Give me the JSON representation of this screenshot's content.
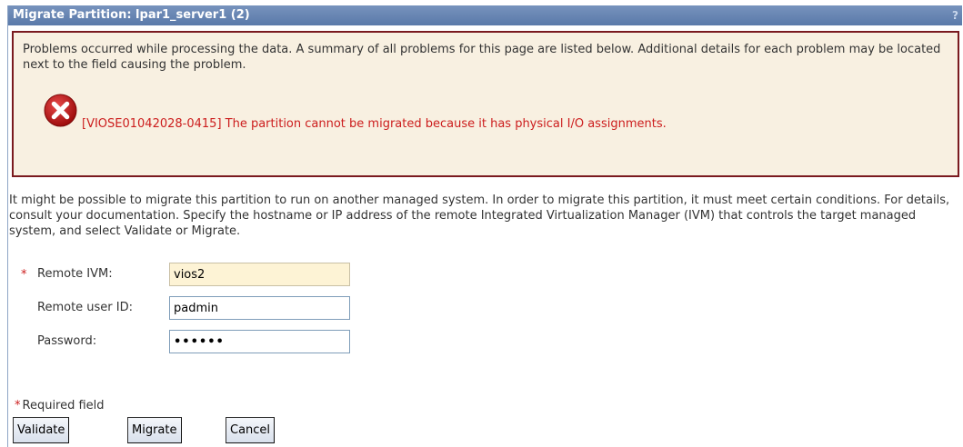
{
  "window": {
    "title": "Migrate Partition: lpar1_server1 (2)",
    "help_symbol": "?"
  },
  "error": {
    "summary": "Problems occurred while processing the data. A summary of all problems for this page are listed below. Additional details for each problem may be located next to the field causing the problem.",
    "icon": "error-x-icon",
    "message": "[VIOSE01042028-0415] The partition cannot be migrated because it has physical I/O assignments."
  },
  "instructions": "It might be possible to migrate this partition to run on another managed system. In order to migrate this partition, it must meet certain conditions. For details, consult your documentation. Specify the hostname or IP address of the remote Integrated Virtualization Manager (IVM) that controls the target managed system, and select Validate or Migrate.",
  "form": {
    "remote_ivm": {
      "label": "Remote IVM:",
      "value": "vios2",
      "required_marker": "*"
    },
    "remote_user": {
      "label": "Remote user ID:",
      "value": "padmin"
    },
    "password": {
      "label": "Password:",
      "value": "••••••"
    }
  },
  "required_note": {
    "marker": "*",
    "text": "Required field"
  },
  "buttons": {
    "validate": "Validate",
    "migrate": "Migrate",
    "cancel": "Cancel"
  },
  "colors": {
    "title_bar": "#5a79a9",
    "error_border": "#7a1a1f",
    "error_background": "#f8f0e1",
    "error_text": "#cc1d1d",
    "required_field_background": "#fdf3d5"
  }
}
